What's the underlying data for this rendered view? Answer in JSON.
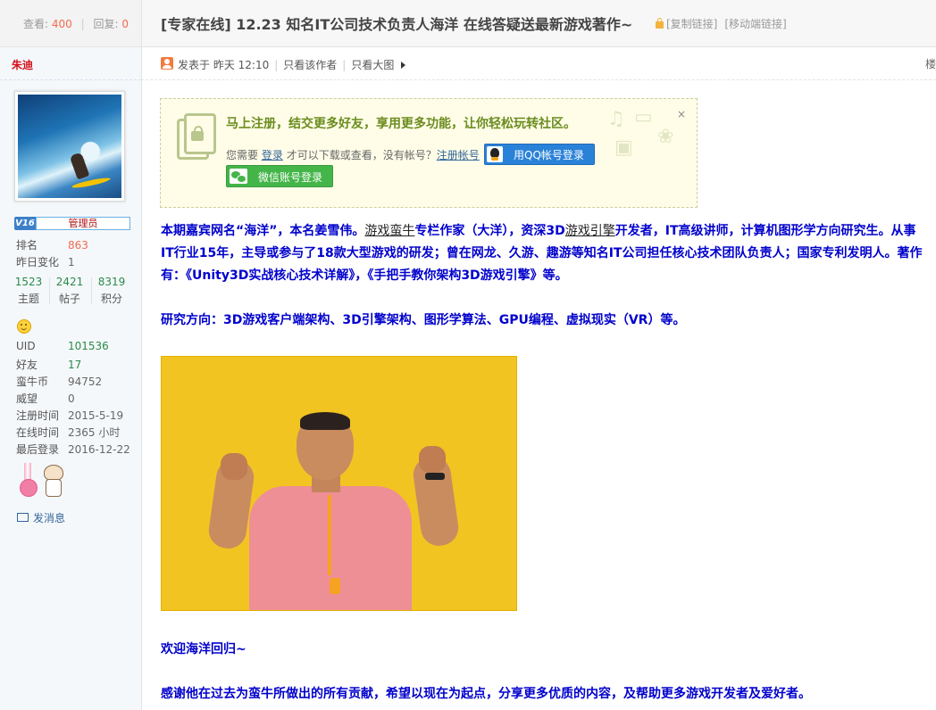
{
  "topbar": {
    "views_label": "查看:",
    "views": "400",
    "replies_label": "回复:",
    "replies": "0",
    "title": "[专家在线] 12.23 知名IT公司技术负责人海洋 在线答疑送最新游戏著作~",
    "copy_link": "[复制链接]",
    "mobile_link": "[移动端链接]"
  },
  "user": {
    "name": "朱迪",
    "level": "V16",
    "role": "管理员",
    "stats_top": [
      {
        "k": "排名",
        "v": "863"
      },
      {
        "k": "昨日变化",
        "v": "1"
      }
    ],
    "tri": [
      {
        "n": "1523",
        "l": "主题"
      },
      {
        "n": "2421",
        "l": "帖子"
      },
      {
        "n": "8319",
        "l": "积分"
      }
    ],
    "stats": [
      {
        "k": "UID",
        "v": "101536"
      },
      {
        "k": "好友",
        "v": "17"
      },
      {
        "k": "蛮牛币",
        "v": "94752"
      },
      {
        "k": "威望",
        "v": "0"
      },
      {
        "k": "注册时间",
        "v": "2015-5-19"
      },
      {
        "k": "在线时间",
        "v": "2365 小时"
      },
      {
        "k": "最后登录",
        "v": "2016-12-22"
      }
    ],
    "send_msg": "发消息"
  },
  "post_meta": {
    "posted": "发表于 昨天 12:10",
    "author_only": "只看该作者",
    "big_image": "只看大图",
    "right_char": "楼"
  },
  "login_box": {
    "title": "马上注册，结交更多好友，享用更多功能，让你轻松玩转社区。",
    "line_prefix": "您需要",
    "login": "登录",
    "line_mid": "才可以下载或查看，没有帐号？",
    "register": "注册帐号",
    "qq_login": "用QQ帐号登录",
    "wechat_login": "微信账号登录",
    "close": "×"
  },
  "article": {
    "p1_a": "本期嘉宾网名“海洋”，本名姜雪伟。",
    "p1_link1": "游戏蛮牛",
    "p1_b": "专栏作家（大洋），资深3D",
    "p1_link2": "游戏引擎",
    "p1_c": "开发者，IT高级讲师，计算机图形学方向研究生。从事IT行业15年，主导或参与了18款大型游戏的研发；曾在网龙、久游、趣游等知名IT公司担任核心技术团队负责人；国家专利发明人。著作有：《Unity3D实战核心技术详解》，《手把手教你架构3D游戏引擎》等。",
    "p2": "研究方向：3D游戏客户端架构、3D引擎架构、图形学算法、GPU编程、虚拟现实（VR）等。",
    "p3": "欢迎海洋回归~",
    "p4": "感谢他在过去为蛮牛所做出的所有贡献，希望以现在为起点，分享更多优质的内容，及帮助更多游戏开发者及爱好者。"
  },
  "colors": {
    "accent_red": "#f26c4f",
    "article_blue": "#0000cc",
    "login_green": "#6b8c1f",
    "qq_blue": "#2a82d8",
    "wechat_green": "#44b549"
  },
  "icons": [
    "lock-icon",
    "user-post-icon",
    "arrow-right-icon",
    "register-lock-icon",
    "qq-penguin-icon",
    "wechat-icon",
    "smile-icon",
    "envelope-icon",
    "close-icon"
  ]
}
